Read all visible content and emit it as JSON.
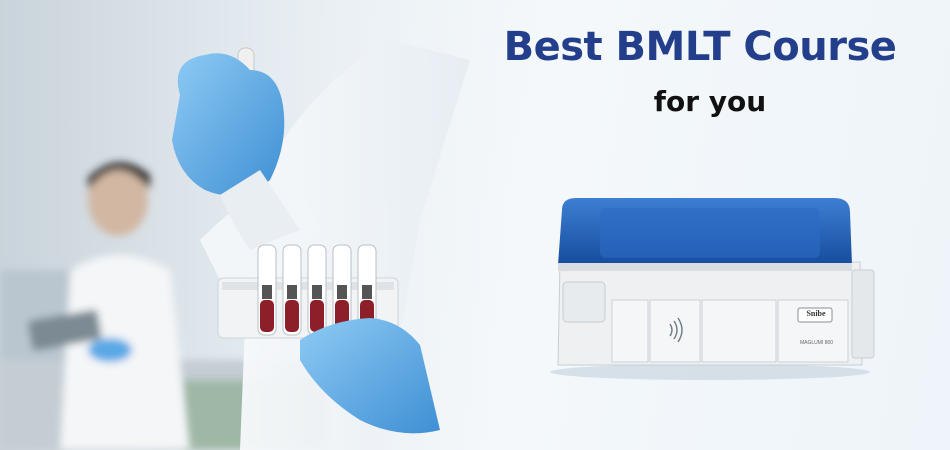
{
  "banner": {
    "title": "Best BMLT Course",
    "subtitle": "for you"
  },
  "analyzer": {
    "brand": "Snibe",
    "model": "MAGLUMI 800"
  },
  "colors": {
    "title": "#233e8b",
    "subtitle": "#111111",
    "glove": "#5aa9e6",
    "analyzer_lid": "#1f5fb8"
  },
  "icons": [
    "nfc-icon"
  ]
}
